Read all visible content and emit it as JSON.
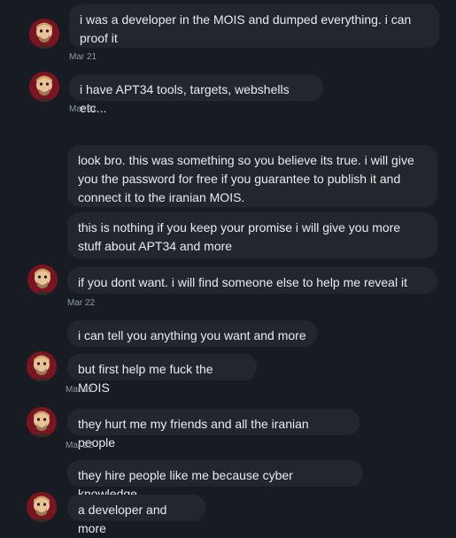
{
  "messages": [
    {
      "text": "i was a developer in the MOIS and dumped everything. i can proof it"
    },
    {
      "text": "i have APT34 tools, targets, webshells etc..."
    },
    {
      "text": "look bro. this was something so you believe its true. i will give you the password for free if you guarantee to publish it and connect it to the iranian MOIS."
    },
    {
      "text": "this is nothing if you keep your promise i will give you more stuff about APT34 and more"
    },
    {
      "text": "if you dont want. i will find someone else to help me reveal it"
    },
    {
      "text": "i can tell you anything you want and more"
    },
    {
      "text": "but first help me fuck the MOIS"
    },
    {
      "text": "they hurt me my friends and all the iranian people"
    },
    {
      "text": "they hire people like me because cyber knowledge"
    },
    {
      "text": "a developer and more"
    }
  ],
  "timestamps": [
    "Mar 21",
    "Mar 21",
    "Mar 22",
    "Mar 22",
    "Mar 22"
  ],
  "avatar": {
    "icon": "user-avatar-icon",
    "color": "#7a1420"
  }
}
